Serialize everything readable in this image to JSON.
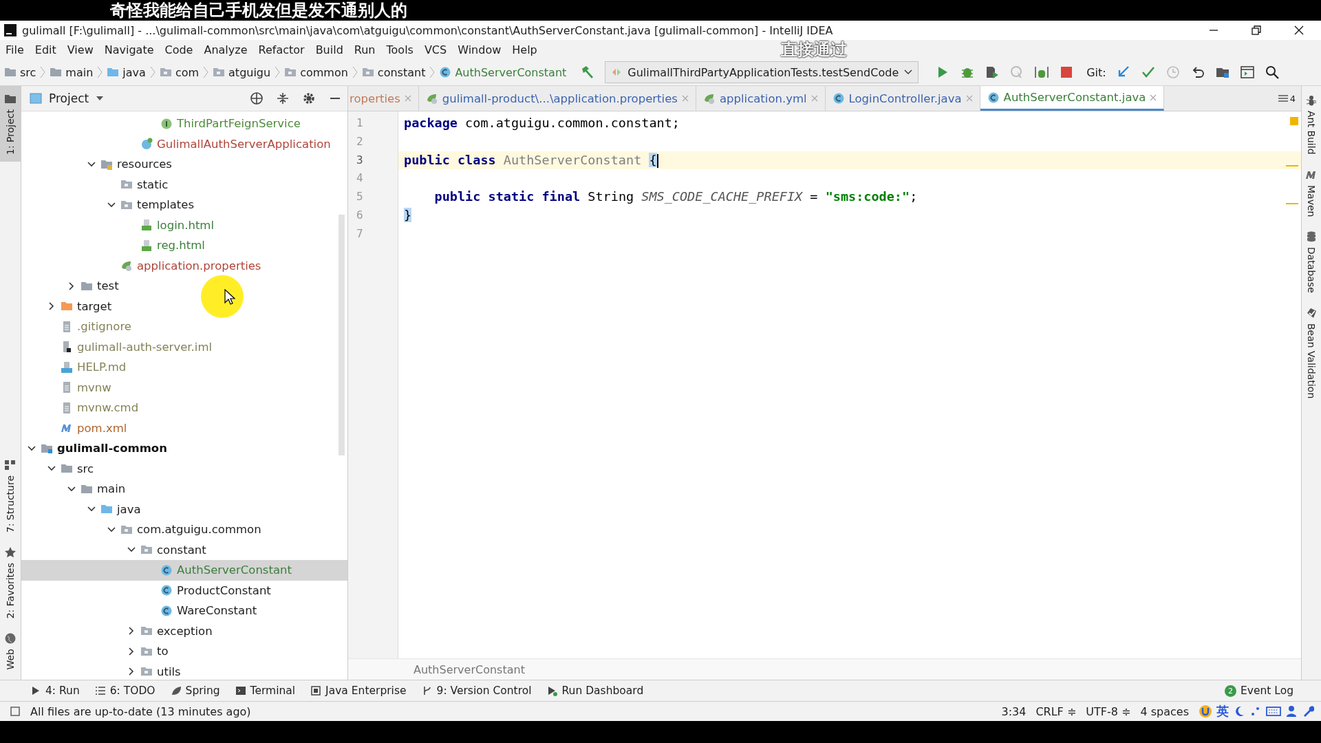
{
  "subtitles": [
    "奇怪我能给自己手机发但是发不通别人的",
    "直接通过"
  ],
  "window": {
    "title": "gulimall [F:\\gulimall] - ...\\gulimall-common\\src\\main\\java\\com\\atguigu\\common\\constant\\AuthServerConstant.java [gulimall-common] - IntelliJ IDEA"
  },
  "menu": [
    "File",
    "Edit",
    "View",
    "Navigate",
    "Code",
    "Analyze",
    "Refactor",
    "Build",
    "Run",
    "Tools",
    "VCS",
    "Window",
    "Help"
  ],
  "breadcrumbs": [
    {
      "label": "src",
      "kind": "folder"
    },
    {
      "label": "main",
      "kind": "folder"
    },
    {
      "label": "java",
      "kind": "source-folder"
    },
    {
      "label": "com",
      "kind": "package"
    },
    {
      "label": "atguigu",
      "kind": "package"
    },
    {
      "label": "common",
      "kind": "package"
    },
    {
      "label": "constant",
      "kind": "package"
    },
    {
      "label": "AuthServerConstant",
      "kind": "class"
    }
  ],
  "run_config": "GulimallThirdPartyApplicationTests.testSendCode",
  "vcs_label": "Git:",
  "project_panel": {
    "title": "Project"
  },
  "tree": [
    {
      "children": [
        {
          "children": [
            {
              "children": [
                {
                  "children": [
                    {
                      "children": [
                        {
                          "children": [
                            {
                              "label": "ThirdPartFeignService",
                              "kind": "interface",
                              "color": "#4f8a3c",
                              "selected": false
                            }
                          ]
                        },
                        {
                          "label": "GulimallAuthServerApplication",
                          "kind": "spring-class",
                          "color": "#b0453a",
                          "selected": false
                        }
                      ]
                    }
                  ]
                },
                {
                  "label": "resources",
                  "kind": "resources-folder",
                  "color": "#1e1e1e",
                  "expanded": true,
                  "selected": false,
                  "children": [
                    {
                      "label": "static",
                      "kind": "package",
                      "color": "#1e1e1e",
                      "selected": false
                    },
                    {
                      "label": "templates",
                      "kind": "package",
                      "color": "#1e1e1e",
                      "expanded": true,
                      "selected": false,
                      "children": [
                        {
                          "label": "login.html",
                          "kind": "html",
                          "color": "#3c7f3c",
                          "selected": false
                        },
                        {
                          "label": "reg.html",
                          "kind": "html",
                          "color": "#3c7f3c",
                          "selected": false
                        }
                      ]
                    },
                    {
                      "label": "application.properties",
                      "kind": "properties",
                      "color": "#b0453a",
                      "selected": false
                    }
                  ]
                }
              ]
            },
            {
              "label": "test",
              "kind": "folder",
              "color": "#1e1e1e",
              "expanded": false,
              "selected": false
            }
          ]
        },
        {
          "label": "target",
          "kind": "excluded-folder",
          "color": "#1e1e1e",
          "expanded": false,
          "selected": false
        },
        {
          "label": ".gitignore",
          "kind": "file",
          "color": "#838358",
          "selected": false
        },
        {
          "label": "gulimall-auth-server.iml",
          "kind": "iml",
          "color": "#838358",
          "selected": false
        },
        {
          "label": "HELP.md",
          "kind": "markdown",
          "color": "#838358",
          "selected": false
        },
        {
          "label": "mvnw",
          "kind": "file",
          "color": "#838358",
          "selected": false
        },
        {
          "label": "mvnw.cmd",
          "kind": "file",
          "color": "#838358",
          "selected": false
        },
        {
          "label": "pom.xml",
          "kind": "maven",
          "color": "#b0652e",
          "selected": false
        }
      ]
    },
    {
      "label": "gulimall-common",
      "kind": "module",
      "color": "#111111",
      "expanded": true,
      "selected": false,
      "children": [
        {
          "label": "src",
          "kind": "folder",
          "color": "#1e1e1e",
          "expanded": true,
          "selected": false,
          "children": [
            {
              "label": "main",
              "kind": "folder",
              "color": "#1e1e1e",
              "expanded": true,
              "selected": false,
              "children": [
                {
                  "label": "java",
                  "kind": "source-folder",
                  "color": "#1e1e1e",
                  "expanded": true,
                  "selected": false,
                  "children": [
                    {
                      "label": "com.atguigu.common",
                      "kind": "package",
                      "color": "#1e1e1e",
                      "expanded": true,
                      "selected": false,
                      "children": [
                        {
                          "label": "constant",
                          "kind": "package",
                          "color": "#1e1e1e",
                          "expanded": true,
                          "selected": false,
                          "children": [
                            {
                              "label": "AuthServerConstant",
                              "kind": "class",
                              "color": "#3c7f3c",
                              "selected": true
                            },
                            {
                              "label": "ProductConstant",
                              "kind": "class",
                              "color": "#1e1e1e",
                              "selected": false
                            },
                            {
                              "label": "WareConstant",
                              "kind": "class",
                              "color": "#1e1e1e",
                              "selected": false
                            }
                          ]
                        },
                        {
                          "label": "exception",
                          "kind": "package",
                          "color": "#1e1e1e",
                          "expanded": false,
                          "selected": false
                        },
                        {
                          "label": "to",
                          "kind": "package",
                          "color": "#1e1e1e",
                          "expanded": false,
                          "selected": false
                        },
                        {
                          "label": "utils",
                          "kind": "package",
                          "color": "#1e1e1e",
                          "expanded": false,
                          "selected": false
                        }
                      ]
                    }
                  ]
                }
              ]
            }
          ]
        }
      ]
    }
  ],
  "editor_tabs": [
    {
      "label": "roperties",
      "color": "#c07a5a",
      "selected": false
    },
    {
      "label": "gulimall-product\\...\\application.properties",
      "kind": "properties",
      "color": "#3b63b0",
      "selected": false
    },
    {
      "label": "application.yml",
      "kind": "properties",
      "color": "#3b63b0",
      "selected": false
    },
    {
      "label": "LoginController.java",
      "kind": "class",
      "color": "#3b63b0",
      "selected": false
    },
    {
      "label": "AuthServerConstant.java",
      "kind": "class",
      "color": "#3c7f3c",
      "selected": true
    }
  ],
  "tab_overflow": "4",
  "code": [
    {
      "number": "1",
      "current": false,
      "tokens": [
        {
          "text": "package",
          "kind": "keyword"
        },
        {
          "text": " com.atguigu.common.constant;",
          "kind": "plain"
        }
      ]
    },
    {
      "number": "2",
      "current": false
    },
    {
      "number": "3",
      "current": true,
      "tokens": [
        {
          "text": "public class",
          "kind": "keyword"
        },
        {
          "text": " AuthServerConstant ",
          "kind": "unused"
        },
        {
          "text": "{",
          "kind": "brace-match"
        }
      ]
    },
    {
      "number": "4",
      "current": false
    },
    {
      "number": "5",
      "current": false,
      "tokens": [
        {
          "text": "    public static final",
          "kind": "keyword"
        },
        {
          "text": " String ",
          "kind": "plain"
        },
        {
          "text": "SMS_CODE_CACHE_PREFIX",
          "kind": "constant"
        },
        {
          "text": " = ",
          "kind": "plain"
        },
        {
          "text": "\"sms:code:\"",
          "kind": "string"
        },
        {
          "text": ";",
          "kind": "plain"
        }
      ]
    },
    {
      "number": "6",
      "current": false,
      "tokens": [
        {
          "text": "}",
          "kind": "brace-match"
        }
      ]
    },
    {
      "number": "7",
      "current": false
    }
  ],
  "editor_breadcrumb": "AuthServerConstant",
  "left_stripe": [
    {
      "label": "1: Project",
      "kind": "project",
      "selected": true
    },
    {
      "label": "7: Structure",
      "kind": "structure",
      "selected": false
    },
    {
      "label": "2: Favorites",
      "kind": "favorites",
      "selected": false
    },
    {
      "label": "Web",
      "kind": "web",
      "selected": false
    }
  ],
  "right_stripe": [
    {
      "label": "Ant Build",
      "kind": "ant"
    },
    {
      "label": "Maven",
      "kind": "maven"
    },
    {
      "label": "Database",
      "kind": "database"
    },
    {
      "label": "Bean Validation",
      "kind": "bean"
    }
  ],
  "tool_windows": [
    {
      "label": "4: Run",
      "kind": "run"
    },
    {
      "label": "6: TODO",
      "kind": "todo"
    },
    {
      "label": "Spring",
      "kind": "spring"
    },
    {
      "label": "Terminal",
      "kind": "terminal"
    },
    {
      "label": "Java Enterprise",
      "kind": "enterprise"
    },
    {
      "label": "9: Version Control",
      "kind": "vcs"
    },
    {
      "label": "Run Dashboard",
      "kind": "dashboard"
    }
  ],
  "event_log": {
    "label": "Event Log",
    "count": "2"
  },
  "status_bar": {
    "message": "All files are up-to-date (13 minutes ago)",
    "position": "3:34",
    "line_separator": "CRLF ≑",
    "encoding": "UTF-8 ≑",
    "indent": "4 spaces",
    "ime": "英"
  }
}
